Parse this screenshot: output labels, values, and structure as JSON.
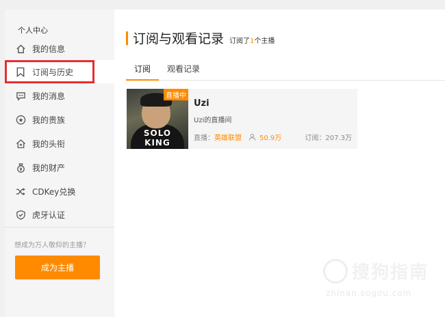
{
  "sidebar": {
    "title": "个人中心",
    "items": [
      {
        "label": "我的信息",
        "icon": "home-icon"
      },
      {
        "label": "订阅与历史",
        "icon": "bookmark-icon",
        "active": true
      },
      {
        "label": "我的消息",
        "icon": "message-icon"
      },
      {
        "label": "我的贵族",
        "icon": "noble-star-icon"
      },
      {
        "label": "我的头衔",
        "icon": "title-house-icon"
      },
      {
        "label": "我的财产",
        "icon": "money-bag-icon"
      },
      {
        "label": "CDKey兑换",
        "icon": "shuffle-icon"
      },
      {
        "label": "虎牙认证",
        "icon": "shield-check-icon"
      }
    ],
    "promo_text": "想成为万人敬仰的主播？",
    "become_streamer_label": "成为主播"
  },
  "main": {
    "title": "订阅与观看记录",
    "subscribed_prefix": "订阅了",
    "subscribed_count": "1",
    "subscribed_suffix": "个主播",
    "tabs": [
      {
        "label": "订阅",
        "active": true
      },
      {
        "label": "观看记录",
        "active": false
      }
    ],
    "card": {
      "live_badge": "直播中",
      "thumbnail_text": "SOLO KING",
      "streamer_name": "Uzi",
      "room_name": "Uzi的直播间",
      "category_prefix": "直播：",
      "category": "英雄联盟",
      "viewers": "50.9万",
      "subscribers": "订阅：207.3万"
    }
  },
  "watermark": {
    "text": "搜狗指南",
    "url": "zhinan.sogou.com"
  },
  "colors": {
    "accent": "#ff8a00",
    "highlight_box": "#e82d2d"
  }
}
